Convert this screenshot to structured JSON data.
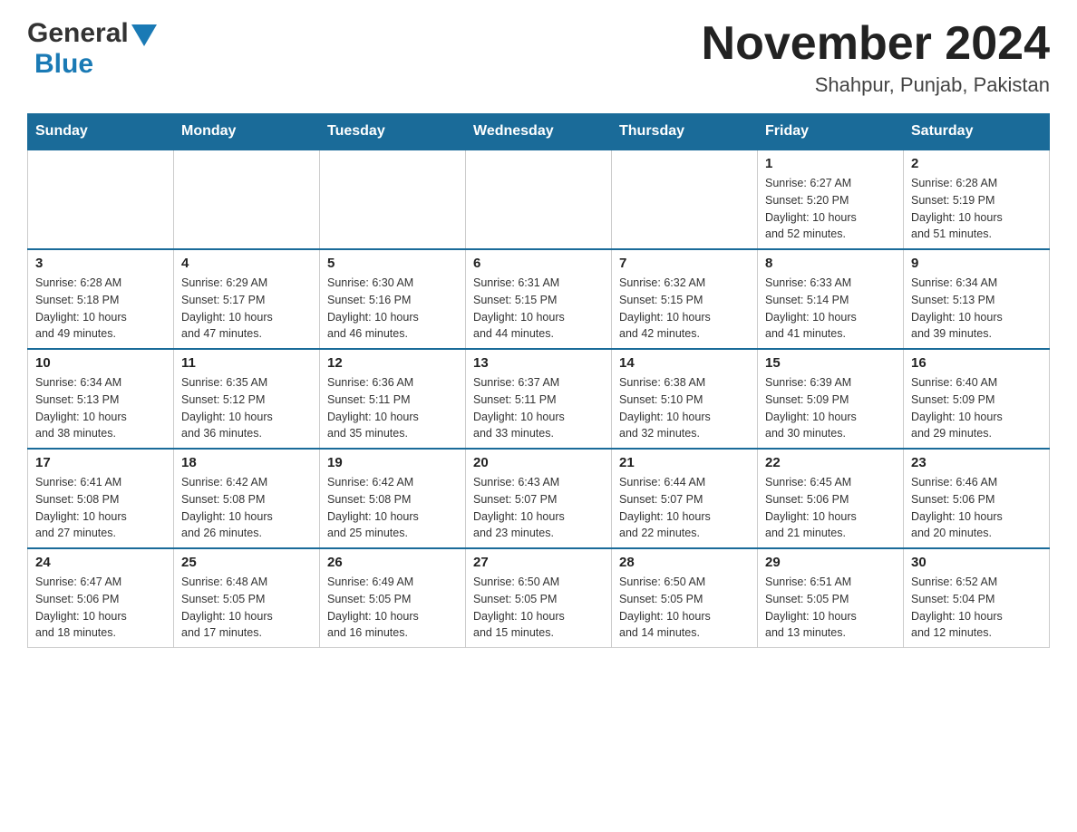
{
  "header": {
    "logo_general": "General",
    "logo_blue": "Blue",
    "month_title": "November 2024",
    "location": "Shahpur, Punjab, Pakistan"
  },
  "weekdays": [
    "Sunday",
    "Monday",
    "Tuesday",
    "Wednesday",
    "Thursday",
    "Friday",
    "Saturday"
  ],
  "weeks": [
    [
      {
        "day": "",
        "info": ""
      },
      {
        "day": "",
        "info": ""
      },
      {
        "day": "",
        "info": ""
      },
      {
        "day": "",
        "info": ""
      },
      {
        "day": "",
        "info": ""
      },
      {
        "day": "1",
        "info": "Sunrise: 6:27 AM\nSunset: 5:20 PM\nDaylight: 10 hours\nand 52 minutes."
      },
      {
        "day": "2",
        "info": "Sunrise: 6:28 AM\nSunset: 5:19 PM\nDaylight: 10 hours\nand 51 minutes."
      }
    ],
    [
      {
        "day": "3",
        "info": "Sunrise: 6:28 AM\nSunset: 5:18 PM\nDaylight: 10 hours\nand 49 minutes."
      },
      {
        "day": "4",
        "info": "Sunrise: 6:29 AM\nSunset: 5:17 PM\nDaylight: 10 hours\nand 47 minutes."
      },
      {
        "day": "5",
        "info": "Sunrise: 6:30 AM\nSunset: 5:16 PM\nDaylight: 10 hours\nand 46 minutes."
      },
      {
        "day": "6",
        "info": "Sunrise: 6:31 AM\nSunset: 5:15 PM\nDaylight: 10 hours\nand 44 minutes."
      },
      {
        "day": "7",
        "info": "Sunrise: 6:32 AM\nSunset: 5:15 PM\nDaylight: 10 hours\nand 42 minutes."
      },
      {
        "day": "8",
        "info": "Sunrise: 6:33 AM\nSunset: 5:14 PM\nDaylight: 10 hours\nand 41 minutes."
      },
      {
        "day": "9",
        "info": "Sunrise: 6:34 AM\nSunset: 5:13 PM\nDaylight: 10 hours\nand 39 minutes."
      }
    ],
    [
      {
        "day": "10",
        "info": "Sunrise: 6:34 AM\nSunset: 5:13 PM\nDaylight: 10 hours\nand 38 minutes."
      },
      {
        "day": "11",
        "info": "Sunrise: 6:35 AM\nSunset: 5:12 PM\nDaylight: 10 hours\nand 36 minutes."
      },
      {
        "day": "12",
        "info": "Sunrise: 6:36 AM\nSunset: 5:11 PM\nDaylight: 10 hours\nand 35 minutes."
      },
      {
        "day": "13",
        "info": "Sunrise: 6:37 AM\nSunset: 5:11 PM\nDaylight: 10 hours\nand 33 minutes."
      },
      {
        "day": "14",
        "info": "Sunrise: 6:38 AM\nSunset: 5:10 PM\nDaylight: 10 hours\nand 32 minutes."
      },
      {
        "day": "15",
        "info": "Sunrise: 6:39 AM\nSunset: 5:09 PM\nDaylight: 10 hours\nand 30 minutes."
      },
      {
        "day": "16",
        "info": "Sunrise: 6:40 AM\nSunset: 5:09 PM\nDaylight: 10 hours\nand 29 minutes."
      }
    ],
    [
      {
        "day": "17",
        "info": "Sunrise: 6:41 AM\nSunset: 5:08 PM\nDaylight: 10 hours\nand 27 minutes."
      },
      {
        "day": "18",
        "info": "Sunrise: 6:42 AM\nSunset: 5:08 PM\nDaylight: 10 hours\nand 26 minutes."
      },
      {
        "day": "19",
        "info": "Sunrise: 6:42 AM\nSunset: 5:08 PM\nDaylight: 10 hours\nand 25 minutes."
      },
      {
        "day": "20",
        "info": "Sunrise: 6:43 AM\nSunset: 5:07 PM\nDaylight: 10 hours\nand 23 minutes."
      },
      {
        "day": "21",
        "info": "Sunrise: 6:44 AM\nSunset: 5:07 PM\nDaylight: 10 hours\nand 22 minutes."
      },
      {
        "day": "22",
        "info": "Sunrise: 6:45 AM\nSunset: 5:06 PM\nDaylight: 10 hours\nand 21 minutes."
      },
      {
        "day": "23",
        "info": "Sunrise: 6:46 AM\nSunset: 5:06 PM\nDaylight: 10 hours\nand 20 minutes."
      }
    ],
    [
      {
        "day": "24",
        "info": "Sunrise: 6:47 AM\nSunset: 5:06 PM\nDaylight: 10 hours\nand 18 minutes."
      },
      {
        "day": "25",
        "info": "Sunrise: 6:48 AM\nSunset: 5:05 PM\nDaylight: 10 hours\nand 17 minutes."
      },
      {
        "day": "26",
        "info": "Sunrise: 6:49 AM\nSunset: 5:05 PM\nDaylight: 10 hours\nand 16 minutes."
      },
      {
        "day": "27",
        "info": "Sunrise: 6:50 AM\nSunset: 5:05 PM\nDaylight: 10 hours\nand 15 minutes."
      },
      {
        "day": "28",
        "info": "Sunrise: 6:50 AM\nSunset: 5:05 PM\nDaylight: 10 hours\nand 14 minutes."
      },
      {
        "day": "29",
        "info": "Sunrise: 6:51 AM\nSunset: 5:05 PM\nDaylight: 10 hours\nand 13 minutes."
      },
      {
        "day": "30",
        "info": "Sunrise: 6:52 AM\nSunset: 5:04 PM\nDaylight: 10 hours\nand 12 minutes."
      }
    ]
  ]
}
